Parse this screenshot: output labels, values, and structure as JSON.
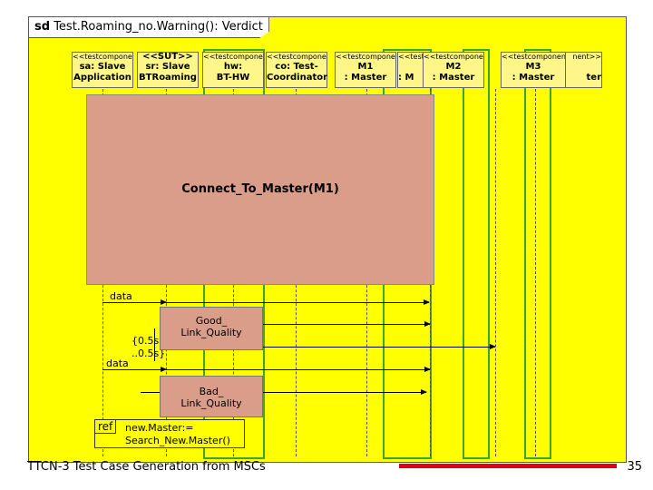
{
  "frame": {
    "keyword": "sd",
    "title": "Test.Roaming_no.Warning(): Verdict"
  },
  "lifelines": [
    {
      "stereotype": "<<testcomponent>>",
      "name": "sa: Slave",
      "name2": "Application"
    },
    {
      "stereotype": "<<SUT>>",
      "name": "sr: Slave",
      "name2": "BTRoaming"
    },
    {
      "stereotype": "<<testcomponent>>",
      "name": "hw:",
      "name2": "BT-HW"
    },
    {
      "stereotype": "<<testcomponent>>",
      "name": "co: Test-",
      "name2": "Coordinator"
    },
    {
      "stereotype": "<<testcomponent>>",
      "name": "M1",
      "name2": ": Master"
    },
    {
      "stereotype": "<<testcomponent>>",
      "name": "M2",
      "name2": ": Master"
    },
    {
      "stereotype": "<<testcomponent>>",
      "name": "M3",
      "name2": ": Master"
    }
  ],
  "ghost_text": {
    "m2_under_left": ": M",
    "m3_under_right": "ter",
    "m2_stereo_prefix": "<<testc",
    "m3_stereo_suffix": "nent>>"
  },
  "interaction_ref": {
    "label": "Connect_To_Master(M1)"
  },
  "messages": {
    "data_top": "data",
    "data_bottom": "data"
  },
  "timer": {
    "line1": "{0.5s",
    "line2": "..0.5s}"
  },
  "inline_refs": {
    "good": {
      "line1": "Good_",
      "line2": "Link_Quality"
    },
    "bad": {
      "line1": "Bad_",
      "line2": "Link_Quality"
    }
  },
  "ref_operator": {
    "tag": "ref",
    "line1": "new.Master:=",
    "line2": "Search_New.Master()"
  },
  "footer": {
    "text": "TTCN-3 Test Case Generation from MSCs",
    "page": "35"
  },
  "colors": {
    "background": "#ffff00",
    "ref_fill": "#da9d8a",
    "header_fill": "#fff68a",
    "accent_green": "#3aa53a",
    "footer_bar": "#e0001b"
  }
}
